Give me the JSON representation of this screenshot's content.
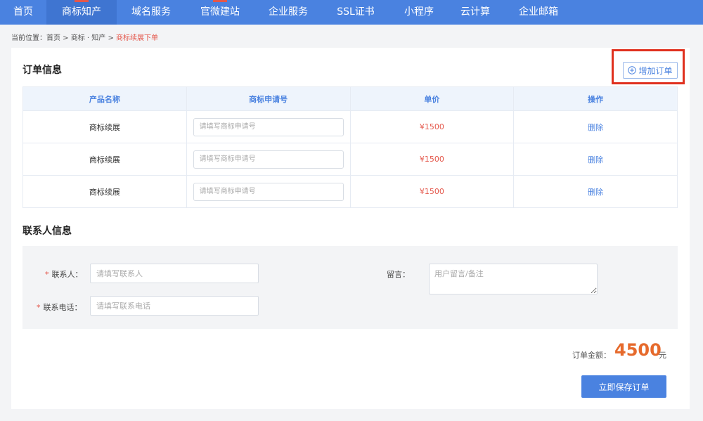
{
  "nav": {
    "items": [
      {
        "label": "首页"
      },
      {
        "label": "商标知产"
      },
      {
        "label": "域名服务"
      },
      {
        "label": "官微建站"
      },
      {
        "label": "企业服务"
      },
      {
        "label": "SSL证书"
      },
      {
        "label": "小程序"
      },
      {
        "label": "云计算"
      },
      {
        "label": "企业邮箱"
      }
    ],
    "active_index": 1,
    "bg_color": "#4a82e0"
  },
  "breadcrumb": {
    "prefix": "当前位置：",
    "home": "首页",
    "sep": " > ",
    "category": "商标 · 知产",
    "current": "商标续展下单"
  },
  "order_section": {
    "title": "订单信息",
    "add_button_label": "增加订单",
    "columns": [
      "产品名称",
      "商标申请号",
      "单价",
      "操作"
    ],
    "rows": [
      {
        "product": "商标续展",
        "placeholder": "请填写商标申请号",
        "price": "¥1500",
        "action": "删除"
      },
      {
        "product": "商标续展",
        "placeholder": "请填写商标申请号",
        "price": "¥1500",
        "action": "删除"
      },
      {
        "product": "商标续展",
        "placeholder": "请填写商标申请号",
        "price": "¥1500",
        "action": "删除"
      }
    ]
  },
  "contact_section": {
    "title": "联系人信息",
    "required_mark": "*",
    "contact_label": "联系人：",
    "contact_placeholder": "请填写联系人",
    "phone_label": "联系电话：",
    "phone_placeholder": "请填写联系电话",
    "note_label": "留言：",
    "note_placeholder": "用户留言/备注"
  },
  "summary": {
    "total_label": "订单金额：",
    "total_amount": "4500",
    "total_unit": "元",
    "save_button_label": "立即保存订单"
  },
  "colors": {
    "accent": "#4a82e0",
    "price": "#e4574b",
    "total": "#e66a2c",
    "highlight": "#e0301e"
  }
}
